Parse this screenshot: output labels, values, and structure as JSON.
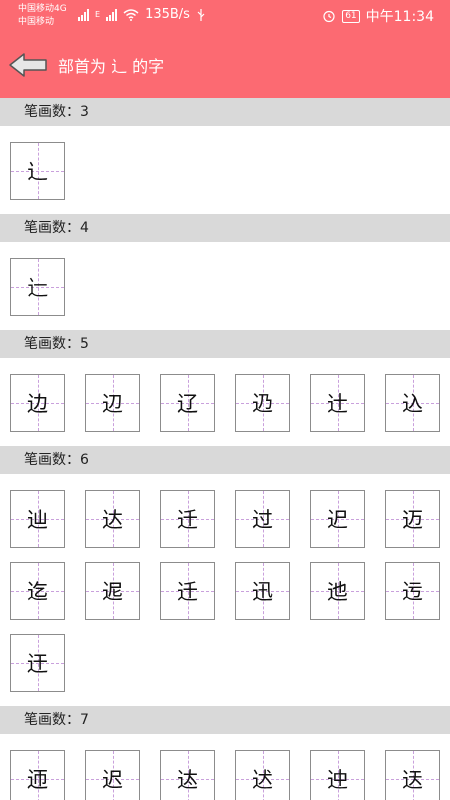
{
  "status_bar": {
    "carrier1": "中国移动4G",
    "carrier2": "中国移动",
    "net_type": "E",
    "speed": "135B/s",
    "battery": "61",
    "time": "中午11:34"
  },
  "app_bar": {
    "title": "部首为 辶 的字"
  },
  "sections": [
    {
      "header": "笔画数：3",
      "chars": [
        "辶"
      ]
    },
    {
      "header": "笔画数：4",
      "chars": [
        "辷"
      ]
    },
    {
      "header": "笔画数：5",
      "chars": [
        "边",
        "辺",
        "辽",
        "辸",
        "辻",
        "込"
      ]
    },
    {
      "header": "笔画数：6",
      "chars": [
        "辿",
        "达",
        "迁",
        "过",
        "迉",
        "迈",
        "迄",
        "迡",
        "迁",
        "迅",
        "迆",
        "迃",
        "迀"
      ]
    },
    {
      "header": "笔画数：7",
      "chars": [
        "迊",
        "迟",
        "迏",
        "迖",
        "迚",
        "迗"
      ]
    }
  ],
  "colors": {
    "accent": "#fc6a72",
    "section_bg": "#d9d9d9",
    "tile_border": "#8c8c8c",
    "guide_line": "#c9a0dc"
  }
}
